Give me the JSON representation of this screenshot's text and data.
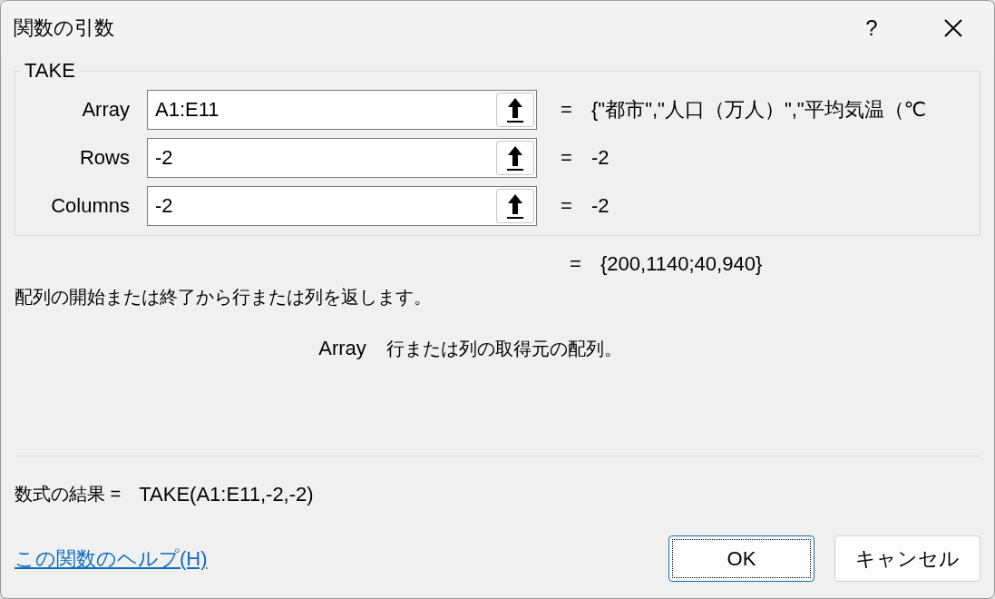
{
  "window": {
    "title": "関数の引数",
    "help_button": "?"
  },
  "function_group": {
    "name": "TAKE",
    "arguments": [
      {
        "label": "Array",
        "value": "A1:E11",
        "equals": "=",
        "result": "{\"都市\",\"人口（万人）\",\"平均気温（℃"
      },
      {
        "label": "Rows",
        "value": "-2",
        "equals": "=",
        "result": "-2"
      },
      {
        "label": "Columns",
        "value": "-2",
        "equals": "=",
        "result": "-2"
      }
    ]
  },
  "function_result": {
    "equals": "=",
    "value": "{200,1140;40,940}"
  },
  "description": "配列の開始または終了から行または列を返します。",
  "argument_help": {
    "name": "Array",
    "text": "行または列の取得元の配列。"
  },
  "formula_result": {
    "label": "数式の結果 =",
    "value": "TAKE(A1:E11,-2,-2)"
  },
  "help_link": "この関数のヘルプ(H)",
  "buttons": [
    {
      "label": "OK",
      "default": true
    },
    {
      "label": "キャンセル",
      "default": false
    }
  ]
}
